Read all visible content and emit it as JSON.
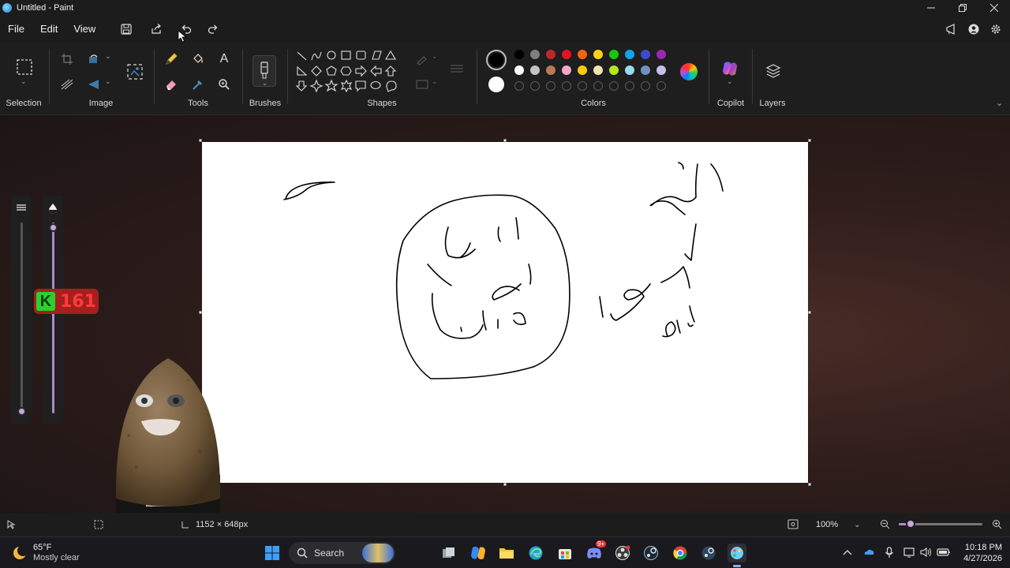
{
  "window": {
    "title": "Untitled - Paint",
    "icon": "paint-app-icon",
    "controls": [
      "minimize-icon",
      "restore-icon",
      "close-icon"
    ]
  },
  "menu": {
    "file": "File",
    "edit": "Edit",
    "view": "View",
    "quick_actions": [
      "save-icon",
      "share-icon",
      "undo-icon",
      "redo-icon"
    ],
    "right_actions": [
      "feedback-icon",
      "account-icon",
      "settings-icon"
    ]
  },
  "ribbon": {
    "groups": {
      "selection": "Selection",
      "image": "Image",
      "tools": "Tools",
      "brushes": "Brushes",
      "shapes": "Shapes",
      "colors": "Colors",
      "copilot": "Copilot",
      "layers": "Layers"
    },
    "tools": [
      "pencil-icon",
      "fill-icon",
      "text-icon",
      "eraser-icon",
      "color-picker-icon",
      "magnifier-icon"
    ],
    "colors": {
      "primary": "#000000",
      "secondary": "#ffffff",
      "palette_row1": [
        "#000000",
        "#7f7f7f",
        "#c1272d",
        "#e81123",
        "#f7630c",
        "#fcd116",
        "#16c60c",
        "#0ea5e9",
        "#3b4cca",
        "#9c27b0"
      ],
      "palette_row2": [
        "#ffffff",
        "#c3c3c3",
        "#b97a57",
        "#f4a6c8",
        "#ffc90e",
        "#efe4b0",
        "#b5e61d",
        "#99d9ea",
        "#7092be",
        "#c8bfe7"
      ],
      "accent": "#b18ac9"
    }
  },
  "canvas": {
    "background": "#ffffff"
  },
  "overlay": {
    "badge_letter": "K",
    "badge_number": "161"
  },
  "status": {
    "canvas_size": "1152 × 648px",
    "zoom": "100%"
  },
  "taskbar": {
    "weather_temp": "65°F",
    "weather_desc": "Mostly clear",
    "search_label": "Search",
    "time": "10:18 PM",
    "date": "4/27/2026",
    "discord_badge": "9+"
  }
}
